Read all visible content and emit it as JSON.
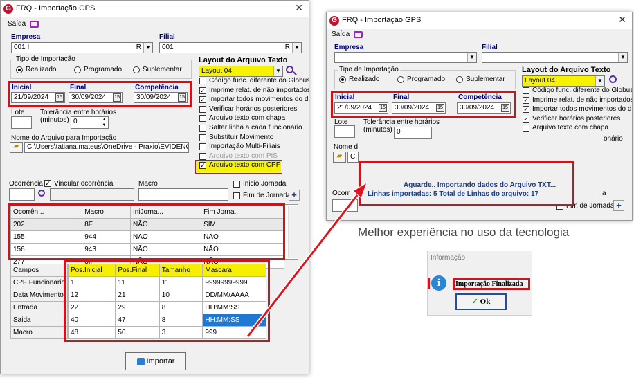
{
  "left": {
    "title": "FRQ - Importação GPS",
    "menu_saida": "Saída",
    "empresa_label": "Empresa",
    "empresa_value": "001 I",
    "empresa_suffix": "R",
    "filial_label": "Filial",
    "filial_value": "001",
    "filial_suffix": "R",
    "tipo_label": "Tipo de Importação",
    "tipo_options": [
      "Realizado",
      "Programado",
      "Suplementar"
    ],
    "layout_label": "Layout do Arquivo Texto",
    "layout_value": "Layout 04",
    "inicial_label": "Inicial",
    "inicial_value": "21/09/2024",
    "final_label": "Final",
    "final_value": "30/09/2024",
    "competencia_label": "Competência",
    "competencia_value": "30/09/2024",
    "lote_label": "Lote",
    "tolerancia_label": "Tolerância entre horários",
    "minutos_label": "(minutos)",
    "tolerancia_value": "0",
    "arquivo_label": "Nome do Arquivo para Importação",
    "arquivo_value": "C:\\Users\\tatiana.mateus\\OneDrive - Praxio\\EVIDENCIA'",
    "options": [
      {
        "label": "Código func. diferente do Globus",
        "checked": false
      },
      {
        "label": "Imprime relat. de não importados",
        "checked": true
      },
      {
        "label": "Importar todos movimentos do dia",
        "checked": true
      },
      {
        "label": "Verificar horários posteriores",
        "checked": false
      },
      {
        "label": "Arquivo texto com chapa",
        "checked": false
      },
      {
        "label": "Saltar linha a cada funcionário",
        "checked": false
      },
      {
        "label": "Substituir Movimento",
        "checked": false
      },
      {
        "label": "Importação Multi-Filiais",
        "checked": false
      },
      {
        "label": "Arquivo texto com PIS",
        "checked": false
      },
      {
        "label": "Arquivo texto com CPF",
        "checked": true
      }
    ],
    "ocorrencia_label": "Ocorrência",
    "vincular_label": "Vincular ocorrência",
    "macro_label": "Macro",
    "inicio_jornada_label": "Inicio Jornada",
    "fim_jornada_label": "Fim de Jornada",
    "occ_headers": [
      "Ocorrên...",
      "Macro",
      "IniJorna...",
      "Fim Jorna..."
    ],
    "occ_rows": [
      [
        "202",
        "8F",
        "NÃO",
        "SIM"
      ],
      [
        "155",
        "944",
        "NÃO",
        "NÃO"
      ],
      [
        "156",
        "943",
        "NÃO",
        "NÃO"
      ],
      [
        "277",
        "8IF",
        "NÃO",
        "NÃO"
      ]
    ],
    "campos_header": "Campos",
    "campos": [
      "CPF Funcionario",
      "Data Movimento",
      "Entrada",
      "Saida",
      "Macro"
    ],
    "layout_headers": [
      "Pos.Inicial",
      "Pos.Final",
      "Tamanho",
      "Mascara"
    ],
    "layout_rows": [
      [
        "1",
        "11",
        "11",
        "99999999999"
      ],
      [
        "12",
        "21",
        "10",
        "DD/MM/AAAA"
      ],
      [
        "22",
        "29",
        "8",
        "HH:MM:SS"
      ],
      [
        "40",
        "47",
        "8",
        "HH:MM:SS"
      ],
      [
        "48",
        "50",
        "3",
        "999"
      ]
    ],
    "importar_label": "Importar"
  },
  "right": {
    "title": "FRQ - Importação GPS",
    "menu_saida": "Saída",
    "empresa_label": "Empresa",
    "filial_label": "Filial",
    "tipo_label": "Tipo de Importação",
    "tipo_options": [
      "Realizado",
      "Programado",
      "Suplementar"
    ],
    "layout_label": "Layout do Arquivo Texto",
    "layout_value": "Layout 04",
    "inicial_label": "Inicial",
    "inicial_value": "21/09/2024",
    "final_label": "Final",
    "final_value": "30/09/2024",
    "competencia_label": "Competência",
    "competencia_value": "30/09/2024",
    "lote_label": "Lote",
    "tolerancia_label": "Tolerância entre horários",
    "minutos_label": "(minutos)",
    "tolerancia_value": "0",
    "nome_label": "Nome d",
    "arquivo_value": "C:",
    "options": [
      {
        "label": "Código func. diferente do Globus",
        "checked": false
      },
      {
        "label": "Imprime relat. de não importados",
        "checked": true
      },
      {
        "label": "Importar todos movimentos do dia",
        "checked": true
      },
      {
        "label": "Verificar horários posteriores",
        "checked": true
      },
      {
        "label": "Arquivo texto com chapa",
        "checked": false
      }
    ],
    "partial_onario": "onário",
    "progress_line1": "Aguarde.. Importando dados do Arquivo TXT...",
    "progress_line2": "Linhas importadas: 5 Total de Linhas do arquivo: 17",
    "ocorr_partial": "Ocorr",
    "a_partial": "a",
    "fim_jornada_label": "Fim de Jornada"
  },
  "caption": "Melhor experiência no uso da tecnologia",
  "info": {
    "title": "Informação",
    "message": "Importação Finalizada",
    "ok_label": "Ok"
  }
}
